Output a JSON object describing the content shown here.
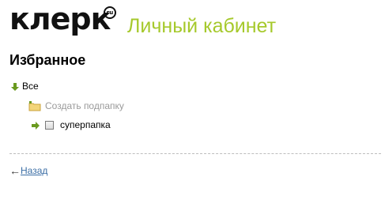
{
  "header": {
    "logo_text": "клерк",
    "logo_badge": "ru",
    "section_title": "Личный кабинет"
  },
  "main": {
    "title": "Избранное",
    "tree": {
      "root_label": "Все",
      "create_subfolder_label": "Создать подпапку",
      "subfolders": [
        {
          "label": "суперпапка",
          "checked": false
        }
      ]
    }
  },
  "footer": {
    "back_arrow": "←",
    "back_label": "Назад"
  },
  "colors": {
    "accent": "#a6c92c",
    "link": "#3b6ea5",
    "muted": "#9a9a9a"
  }
}
